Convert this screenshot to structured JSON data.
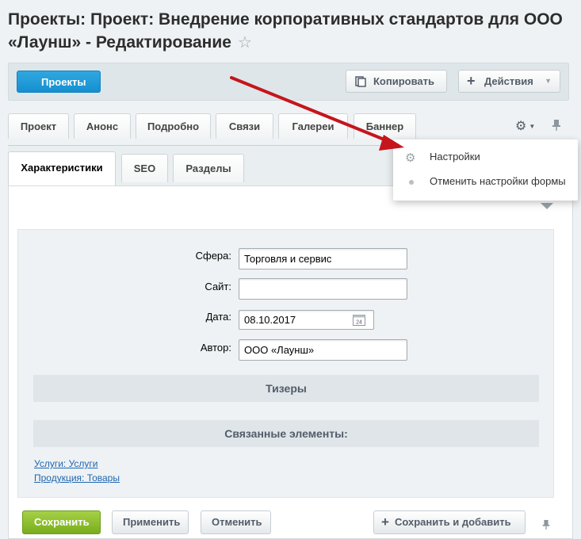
{
  "page": {
    "title": "Проекты: Проект: Внедрение корпоративных стандартов для ООО «Лаунш» - Редактирование"
  },
  "toolbar": {
    "back_label": "Проекты",
    "copy_label": "Копировать",
    "actions_label": "Действия"
  },
  "tabs_top": [
    "Проект",
    "Анонс",
    "Подробно",
    "Связи",
    "Галереи",
    "Баннер"
  ],
  "tabs_sub": [
    "Характеристики",
    "SEO",
    "Разделы"
  ],
  "settings_menu": {
    "items": [
      "Настройки",
      "Отменить настройки формы"
    ]
  },
  "form": {
    "sphere_label": "Сфера:",
    "sphere_value": "Торговля и сервис",
    "site_label": "Сайт:",
    "site_value": "",
    "date_label": "Дата:",
    "date_value": "08.10.2017",
    "calendar_day": "24",
    "author_label": "Автор:",
    "author_value": "ООО «Лаунш»"
  },
  "sections": {
    "teasers": "Тизеры",
    "related": "Связанные элементы:"
  },
  "links": [
    "Услуги: Услуги",
    "Продукция: Товары"
  ],
  "footer": {
    "save": "Сохранить",
    "apply": "Применить",
    "cancel": "Отменить",
    "save_add": "Сохранить и добавить"
  },
  "colors": {
    "accent_blue": "#168fd0",
    "save_green": "#78ae1d",
    "arrow_red": "#c4161c",
    "link_blue": "#2067b0"
  }
}
